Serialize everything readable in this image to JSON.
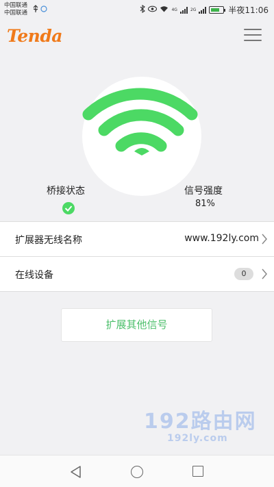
{
  "status_bar": {
    "carrier_1": "中国联通",
    "carrier_2": "中国联通",
    "net_label_1": "4G",
    "net_label_2": "2G",
    "time": "半夜11:06"
  },
  "header": {
    "logo_text": "Tenda"
  },
  "bridge": {
    "label": "桥接状态",
    "status_icon": "check-icon",
    "status": "connected"
  },
  "signal": {
    "label": "信号强度",
    "value": "81%"
  },
  "list": {
    "ssid_label": "扩展器无线名称",
    "ssid_value": "www.192ly.com",
    "devices_label": "在线设备",
    "devices_count": "0"
  },
  "extend_button_label": "扩展其他信号",
  "watermark": {
    "line1": "192路由网",
    "line2": "192ly.com"
  },
  "colors": {
    "accent_green": "#4cd964",
    "logo_orange": "#f07a1a"
  }
}
